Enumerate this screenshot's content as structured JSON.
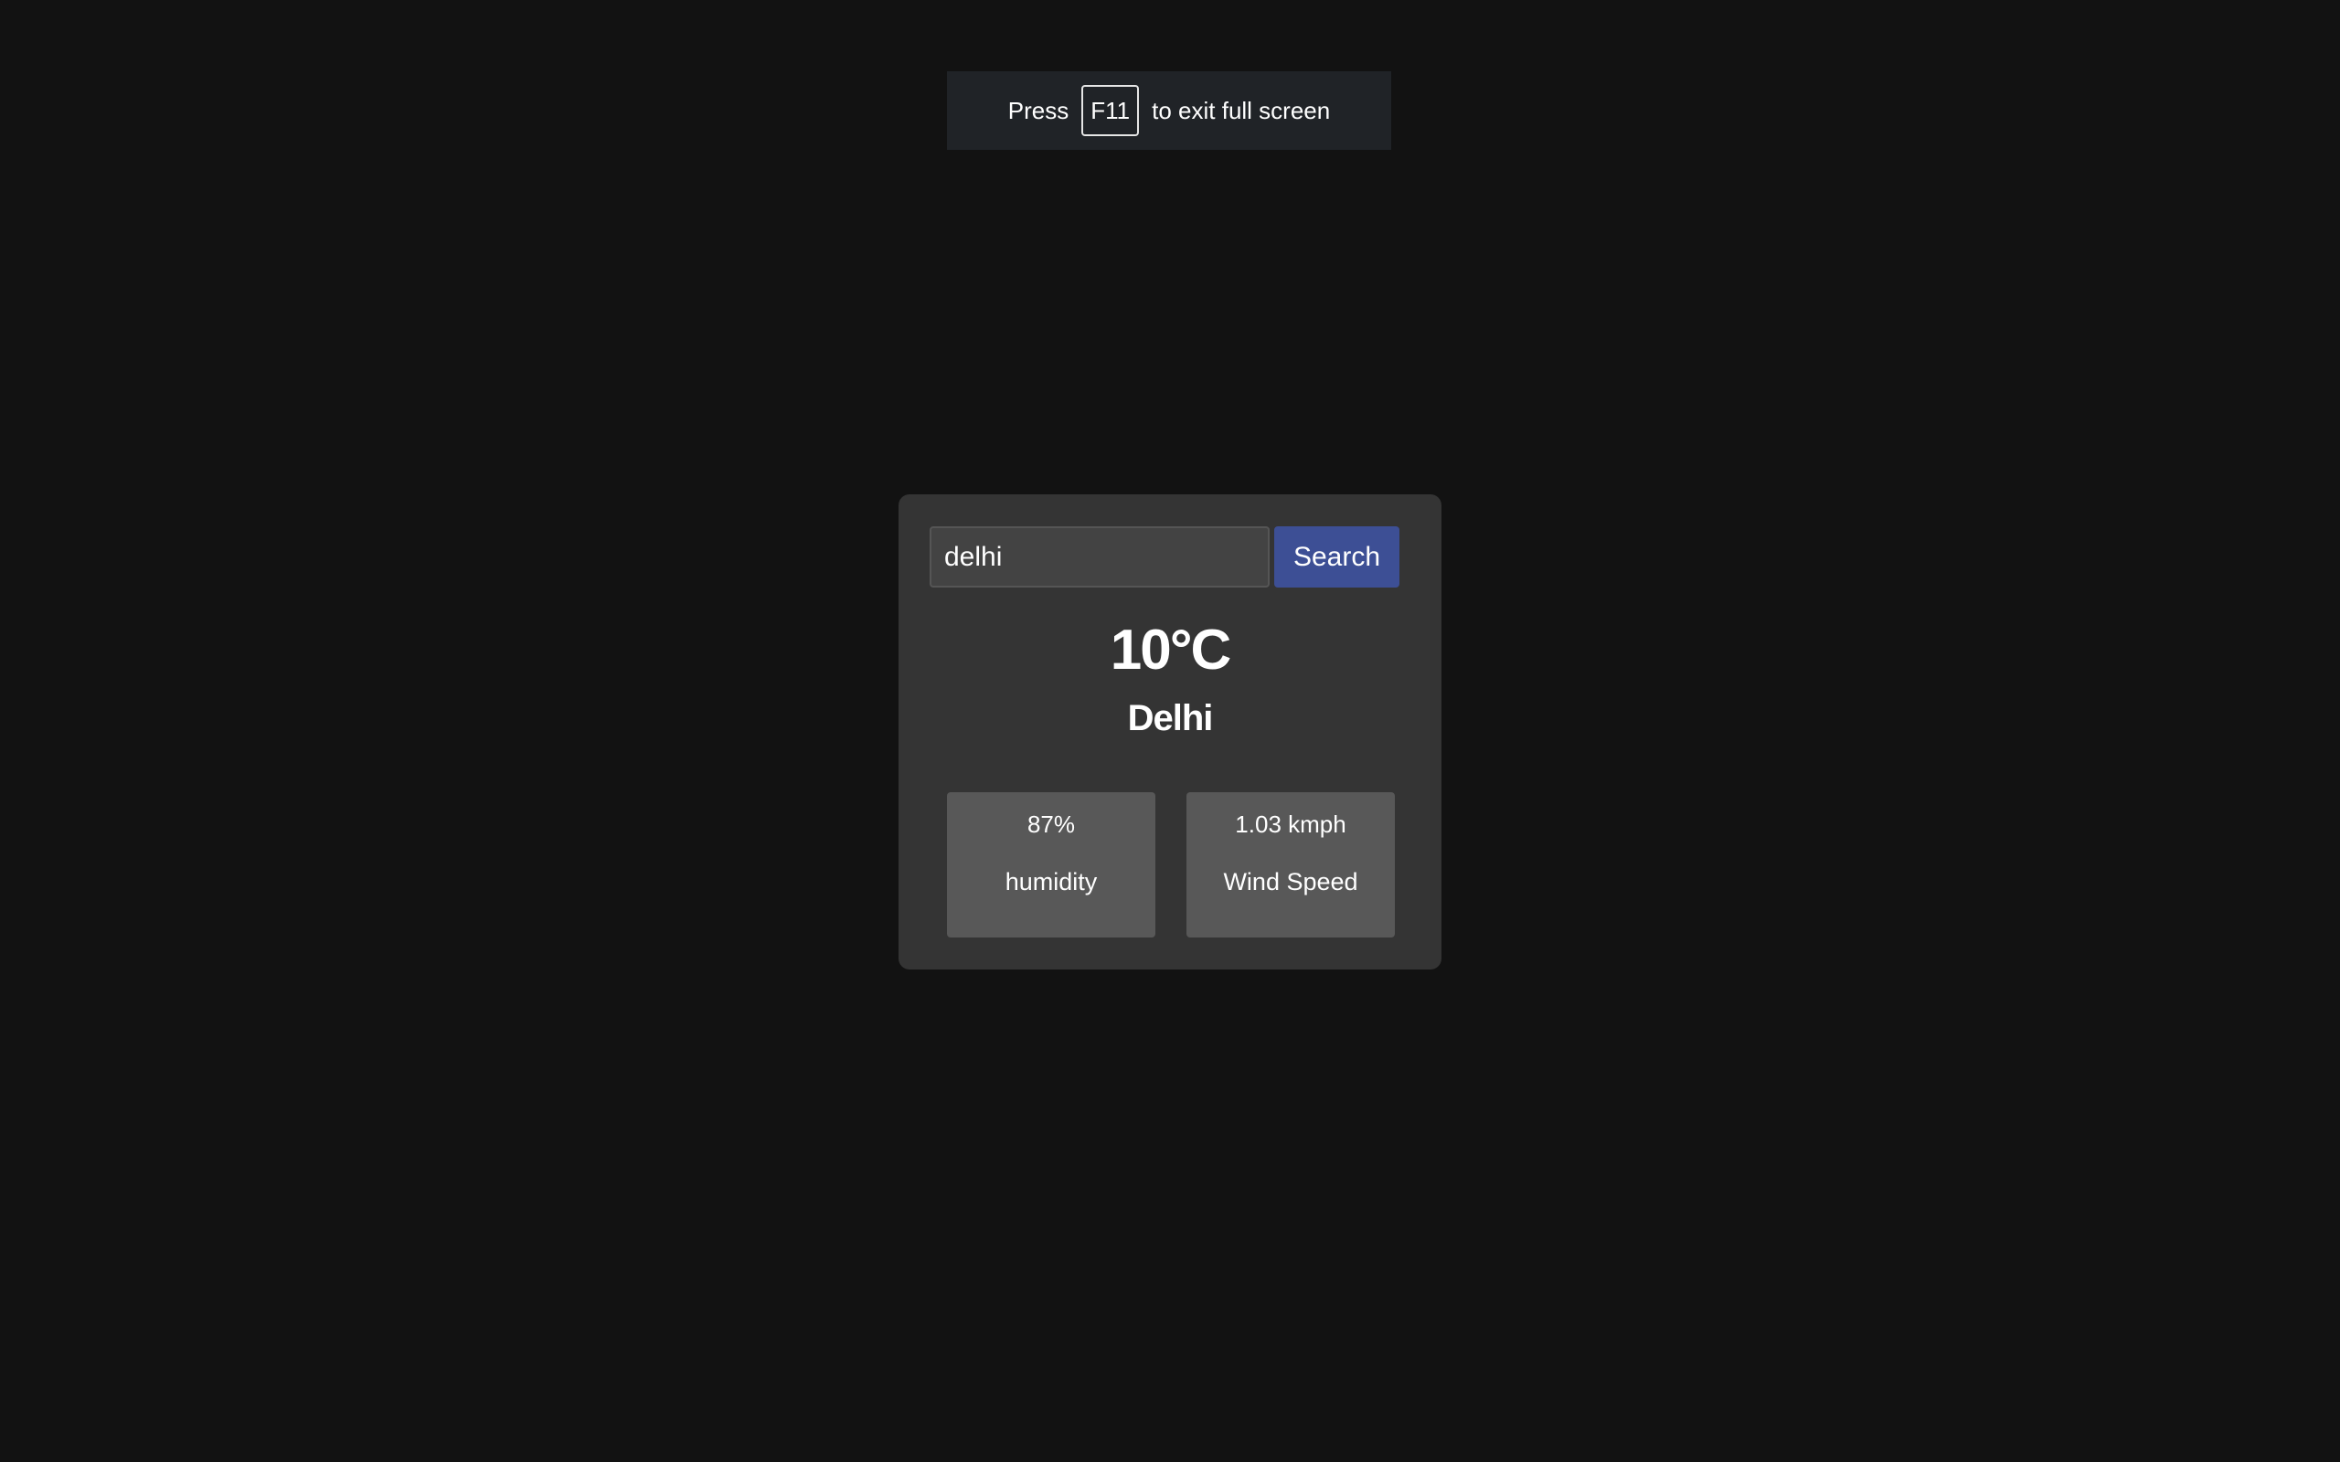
{
  "fullscreen_notice": {
    "prefix": "Press",
    "key": "F11",
    "suffix": "to exit full screen"
  },
  "weather": {
    "search": {
      "value": "delhi",
      "button_label": "Search"
    },
    "temperature": "10°C",
    "city": "Delhi",
    "humidity": {
      "value": "87%",
      "label": "humidity"
    },
    "wind": {
      "value": "1.03 kmph",
      "label": "Wind Speed"
    }
  },
  "colors": {
    "background": "#121212",
    "card": "#343434",
    "stat_box": "#585858",
    "button": "#3d4f95"
  }
}
